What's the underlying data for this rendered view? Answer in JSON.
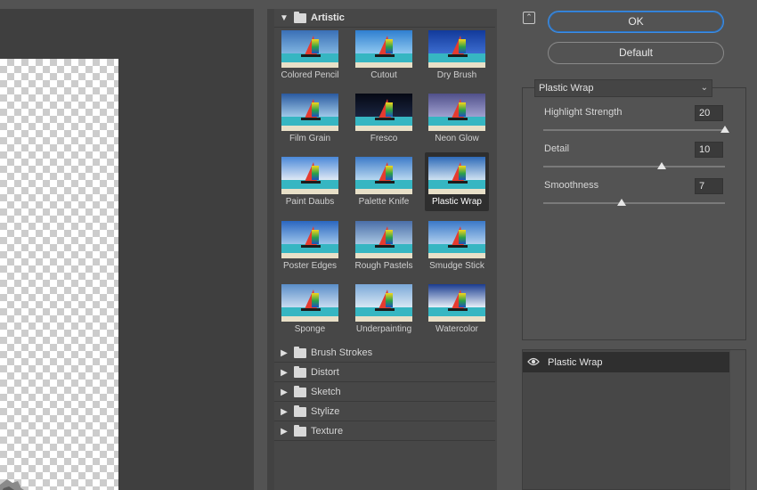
{
  "artistic_category": "Artistic",
  "thumbnails": [
    {
      "label": "Colored Pencil",
      "selected": false
    },
    {
      "label": "Cutout",
      "selected": false
    },
    {
      "label": "Dry Brush",
      "selected": false
    },
    {
      "label": "Film Grain",
      "selected": false
    },
    {
      "label": "Fresco",
      "selected": false
    },
    {
      "label": "Neon Glow",
      "selected": false
    },
    {
      "label": "Paint Daubs",
      "selected": false
    },
    {
      "label": "Palette Knife",
      "selected": false
    },
    {
      "label": "Plastic Wrap",
      "selected": true
    },
    {
      "label": "Poster Edges",
      "selected": false
    },
    {
      "label": "Rough Pastels",
      "selected": false
    },
    {
      "label": "Smudge Stick",
      "selected": false
    },
    {
      "label": "Sponge",
      "selected": false
    },
    {
      "label": "Underpainting",
      "selected": false
    },
    {
      "label": "Watercolor",
      "selected": false
    }
  ],
  "categories": [
    "Brush Strokes",
    "Distort",
    "Sketch",
    "Stylize",
    "Texture"
  ],
  "buttons": {
    "ok": "OK",
    "default": "Default"
  },
  "filter_select": {
    "value": "Plastic Wrap"
  },
  "params": [
    {
      "label": "Highlight Strength",
      "value": "20",
      "level_percent": 100
    },
    {
      "label": "Detail",
      "value": "10",
      "level_percent": 65
    },
    {
      "label": "Smoothness",
      "value": "7",
      "level_percent": 43
    }
  ],
  "effect_layer": {
    "name": "Plastic Wrap"
  },
  "colors": {
    "accent": "#3d8fe6",
    "panel": "#535353",
    "selected_thumb": "#2e2e2e"
  }
}
